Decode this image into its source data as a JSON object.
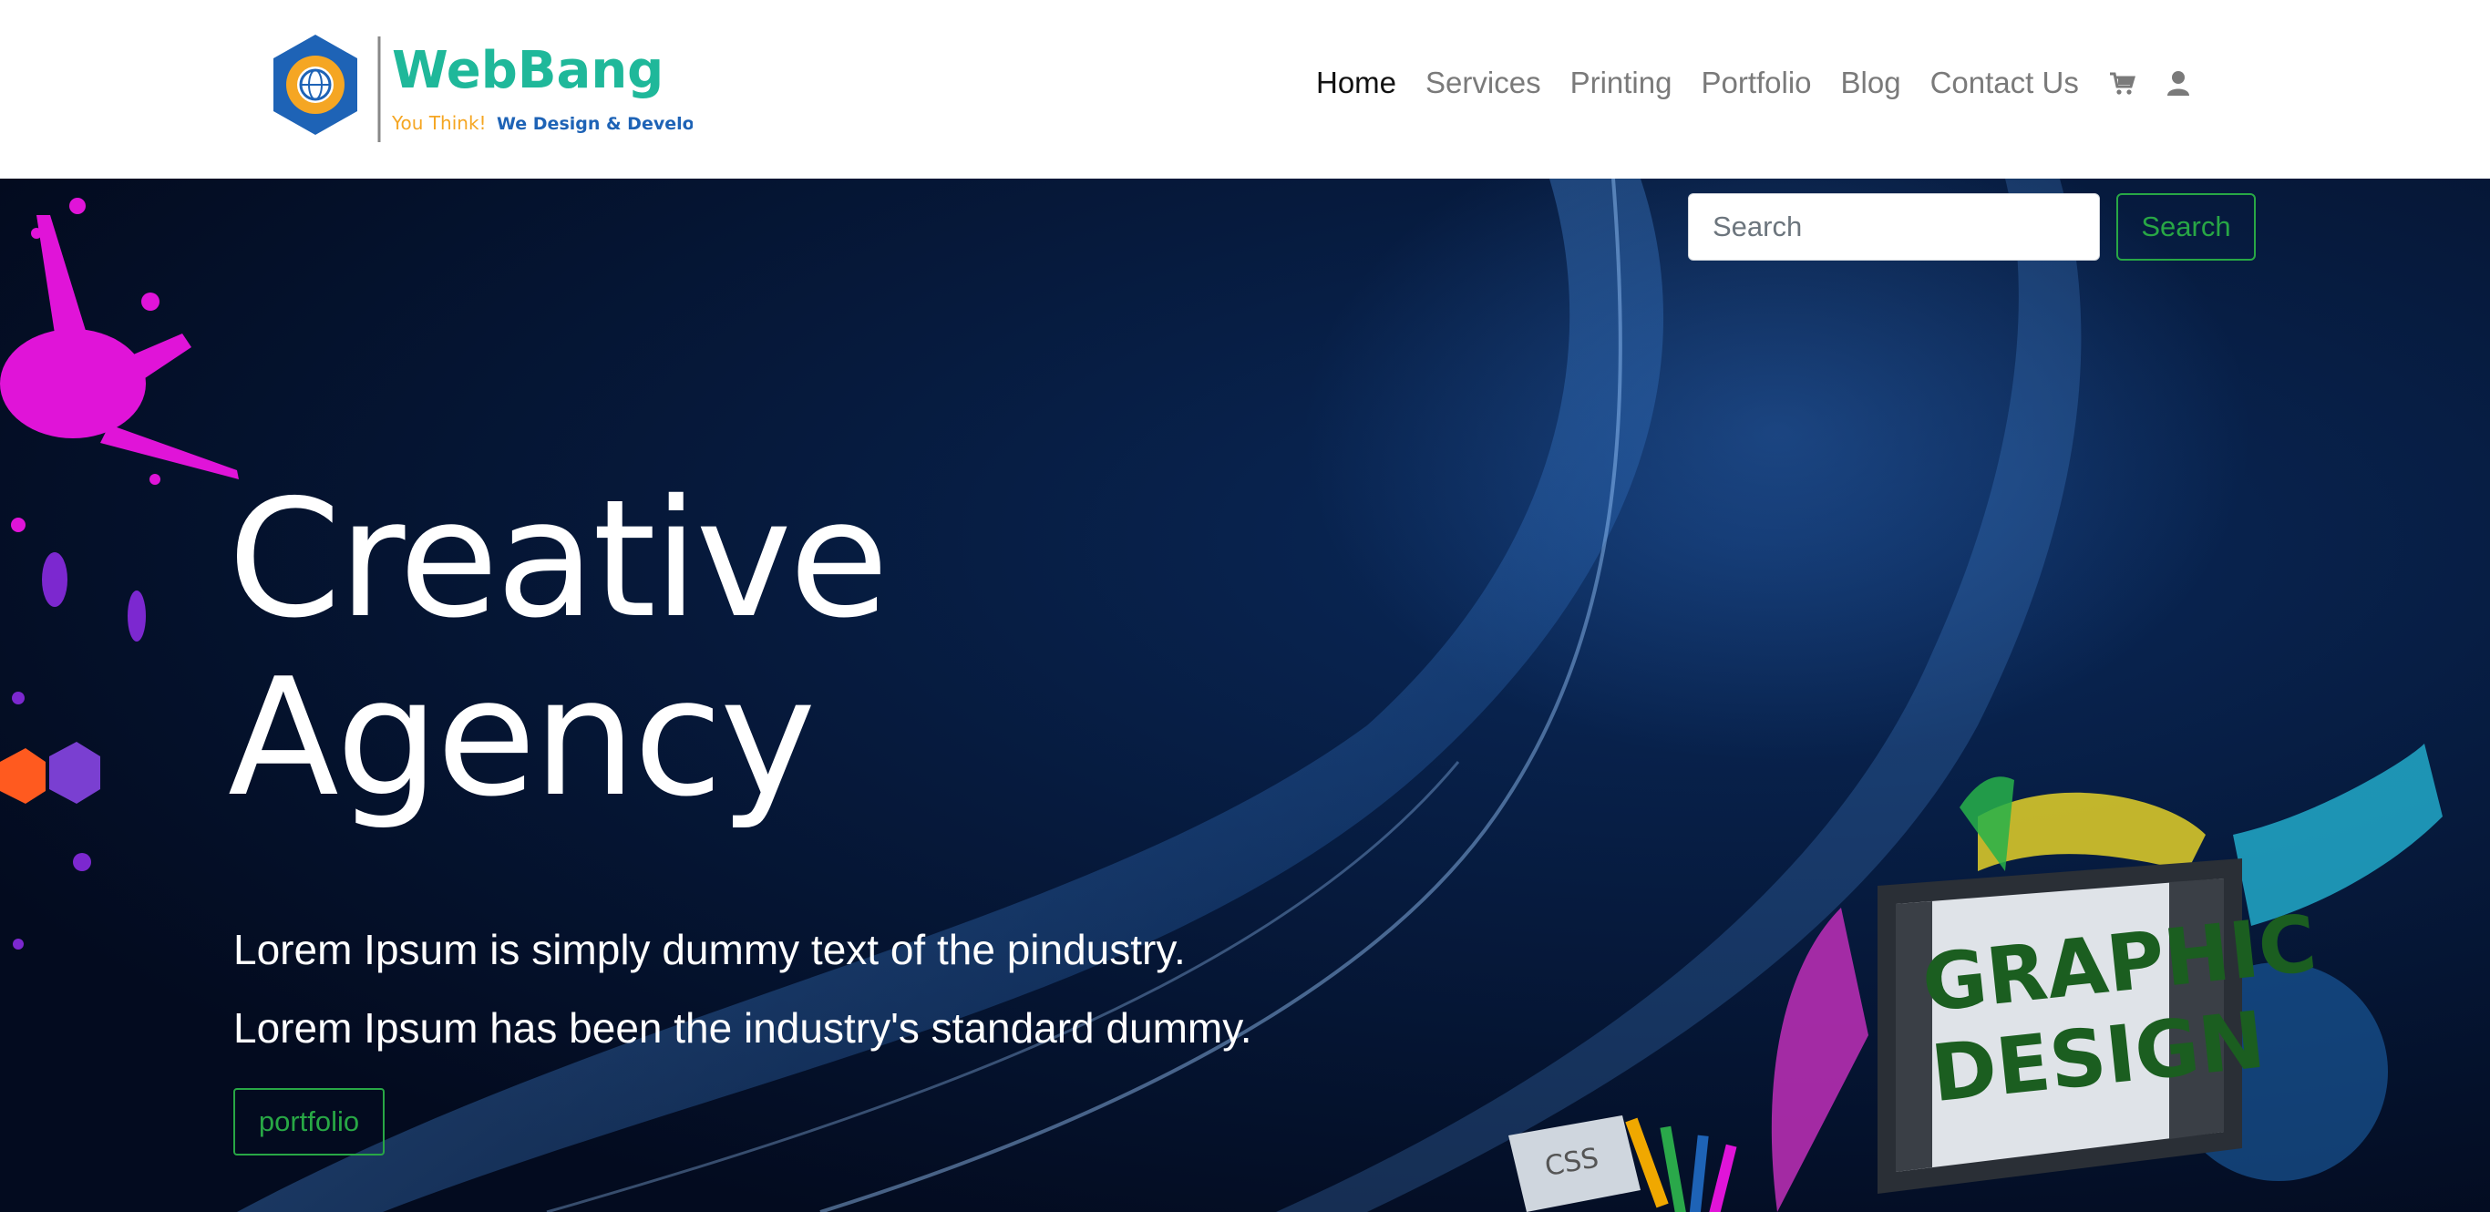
{
  "brand": {
    "name": "WebBang",
    "tagline_part1": "You Think!",
    "tagline_part2": "We Design & Develop"
  },
  "nav": {
    "items": [
      {
        "label": "Home",
        "active": true
      },
      {
        "label": "Services"
      },
      {
        "label": "Printing"
      },
      {
        "label": "Portfolio"
      },
      {
        "label": "Blog"
      },
      {
        "label": "Contact Us"
      }
    ],
    "icons": [
      "cart-icon",
      "user-icon"
    ]
  },
  "search": {
    "placeholder": "Search",
    "button_label": "Search"
  },
  "hero": {
    "title_line1": "Creative",
    "title_line2": "Agency",
    "lead_line1": "Lorem Ipsum is simply dummy text of the pindustry.",
    "lead_line2": "Lorem Ipsum has been the industry's standard dummy.",
    "button_label": "portfolio",
    "illustration_text_line1": "GRAPHIC",
    "illustration_text_line2": "DESIGN",
    "illustration_tag": "CSS"
  },
  "colors": {
    "accent_green": "#28a745",
    "hero_bg": "#061a3d",
    "splash_magenta": "#e014d8",
    "logo_blue": "#1e63b6",
    "logo_teal": "#1fb89a",
    "logo_orange": "#f5a623"
  }
}
